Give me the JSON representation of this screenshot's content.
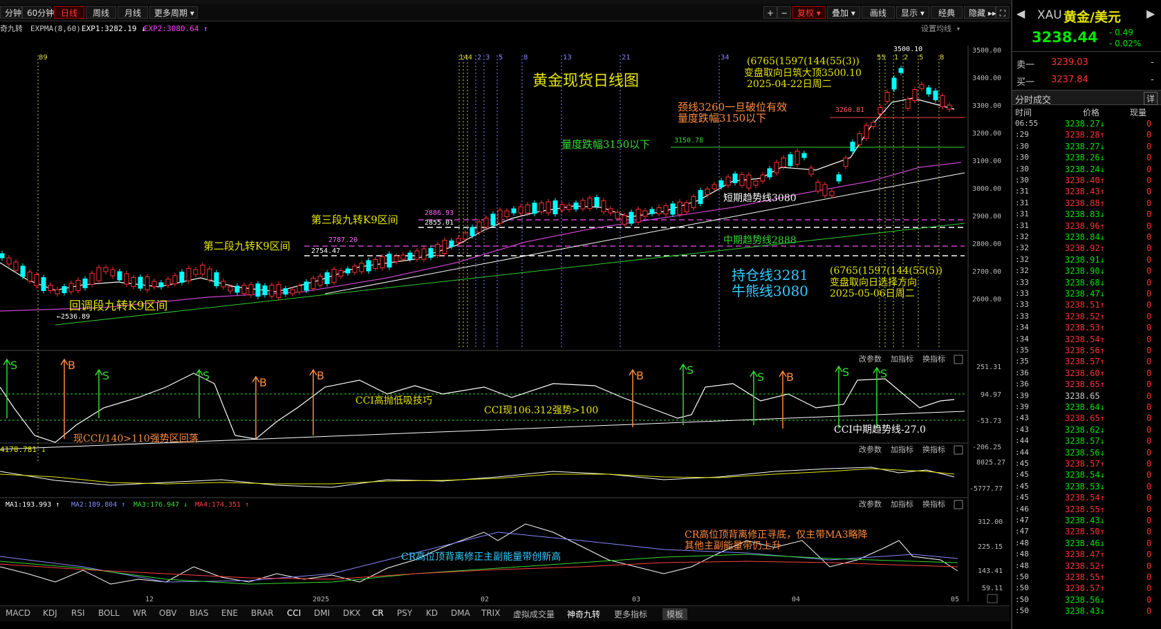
{
  "toolbar": {
    "periods": [
      "分钟",
      "60分钟",
      "日线",
      "周线",
      "月线",
      "更多周期 ▾"
    ],
    "active_period": "日线",
    "right_buttons": [
      "+",
      "−",
      "复权 ▾",
      "叠加 ▾",
      "画线",
      "显示 ▾",
      "经典",
      "隐藏 ▸▸",
      "⛶"
    ]
  },
  "indicator_bar": {
    "name": "奇九转",
    "expma": "EXPMA(8,60)",
    "exp1": "EXP1:3282.19 ↓",
    "exp2": "EXP2:3080.64 ↑",
    "settings": "设置均线 ▾"
  },
  "chart_title": "黄金现货日线图",
  "annotations": {
    "a1_line1": "(6765(1597(144(55(3))",
    "a1_line2": "变盘取向日筑大顶3500.10",
    "a1_line3": "2025-04-22日周二",
    "neck1": "颈线3260一旦破位有效",
    "neck2": "量度跌幅3150以下",
    "measure": "量度跌幅3150以下",
    "nine3": "第三段九转K9区间",
    "nine2": "第二段九转K9区间",
    "nine1": "回调段九转K9区间",
    "short_trend": "短期趋势线3080",
    "mid_trend": "中期趋势线2888",
    "hold": "持仓线3281",
    "bull": "牛熊线3080",
    "a2_line1": "(6765(1597(144(55(5))",
    "a2_line2": "变盘取向日选择方向",
    "a2_line3": "2025-05-06日周二",
    "cci1": "CCI高抛低吸技巧",
    "cci2": "CCI现106.312强势>100",
    "cci3": "现CCI/140>110强势区回落",
    "cci4": "CCI中期趋势线-27.0",
    "cr1": "CR高位顶背离修正主副能量带创新高",
    "cr2": "CR高位顶背离修正寻底，仅主带MA3略降",
    "cr3": "其他主副能量带仍上升"
  },
  "price_labels": {
    "p3500": "3500.10",
    "p3260": "3260.81",
    "p3150": "3150.78",
    "p2886": "2886.93",
    "p2855": "2855.01",
    "p2787": "2787.20",
    "p2754": "2754.47",
    "p2536": "←2536.89"
  },
  "count_labels": {
    "c89": "89",
    "c144": "144",
    "c2": "2",
    "c3": "3",
    "c5": "5",
    "c8": "8",
    "c13": "13",
    "c21": "21",
    "c34": "34",
    "c55": "55",
    "c1": "1"
  },
  "main_axis": [
    "3500.00",
    "3400.00",
    "3300.00",
    "3200.00",
    "3100.00",
    "3000.00",
    "2900.00",
    "2800.00",
    "2700.00",
    "2600.00"
  ],
  "cci_panel": {
    "controls": [
      "改参数",
      "加指标",
      "换指标"
    ],
    "axis": [
      "251.31",
      "94.97",
      "-53.73",
      "-206.25"
    ],
    "b_label": "B",
    "s_label": "S"
  },
  "vol_panel": {
    "header": "4178.781 ↓",
    "controls": [
      "改参数",
      "加指标",
      "换指标"
    ],
    "axis": [
      "8025.27",
      "-5777.77"
    ]
  },
  "cr_panel": {
    "ma1": "MA1:193.993 ↑",
    "ma2": "MA2:189.804 ↑",
    "ma3": "MA3:176.947 ↓",
    "ma4": "MA4:174.351 ↑",
    "controls": [
      "改参数",
      "加指标",
      "换指标"
    ],
    "axis": [
      "312.00",
      "225.15",
      "143.41",
      "59.11"
    ]
  },
  "x_axis": [
    "12",
    "2025",
    "02",
    "03",
    "04",
    "05"
  ],
  "bottom_tabs": [
    "MACD",
    "KDJ",
    "RSI",
    "BOLL",
    "WR",
    "OBV",
    "BIAS",
    "ENE",
    "BRAR",
    "CCI",
    "DMI",
    "DKX",
    "CR",
    "PSY",
    "KD",
    "DMA",
    "TRIX",
    "虚拟成交量",
    "神奇九转",
    "更多指标",
    "模板"
  ],
  "right_panel": {
    "symbol": "XAU",
    "name": "黄金/美元",
    "price": "3238.44",
    "change": "- 0.49",
    "change_pct": "- 0.02%",
    "sell_label": "卖一",
    "sell_price": "3239.03",
    "sell_vol": "-",
    "buy_label": "买一",
    "buy_price": "3237.84",
    "buy_vol": "-",
    "trade_title": "分时成交",
    "trade_btn": "详",
    "col_time": "时间",
    "col_price": "价格",
    "col_vol": "现量",
    "trades": [
      {
        "t": "06:55",
        "p": "3238.27",
        "d": "↓",
        "v": "0"
      },
      {
        "t": ":29",
        "p": "3238.28",
        "d": "↑",
        "v": "0"
      },
      {
        "t": ":30",
        "p": "3238.27",
        "d": "↓",
        "v": "0"
      },
      {
        "t": ":30",
        "p": "3238.26",
        "d": "↓",
        "v": "0"
      },
      {
        "t": ":30",
        "p": "3238.24",
        "d": "↓",
        "v": "0"
      },
      {
        "t": ":30",
        "p": "3238.40",
        "d": "↑",
        "v": "0"
      },
      {
        "t": ":31",
        "p": "3238.43",
        "d": "↑",
        "v": "0"
      },
      {
        "t": ":31",
        "p": "3238.88",
        "d": "↑",
        "v": "0"
      },
      {
        "t": ":31",
        "p": "3238.83",
        "d": "↓",
        "v": "0"
      },
      {
        "t": ":31",
        "p": "3238.96",
        "d": "↑",
        "v": "0"
      },
      {
        "t": ":32",
        "p": "3238.84",
        "d": "↓",
        "v": "0"
      },
      {
        "t": ":32",
        "p": "3238.92",
        "d": "↑",
        "v": "0"
      },
      {
        "t": ":32",
        "p": "3238.91",
        "d": "↓",
        "v": "0"
      },
      {
        "t": ":32",
        "p": "3238.90",
        "d": "↓",
        "v": "0"
      },
      {
        "t": ":33",
        "p": "3238.68",
        "d": "↓",
        "v": "0"
      },
      {
        "t": ":33",
        "p": "3238.47",
        "d": "↓",
        "v": "0"
      },
      {
        "t": ":33",
        "p": "3238.51",
        "d": "↑",
        "v": "0"
      },
      {
        "t": ":33",
        "p": "3238.52",
        "d": "↑",
        "v": "0"
      },
      {
        "t": ":34",
        "p": "3238.53",
        "d": "↑",
        "v": "0"
      },
      {
        "t": ":34",
        "p": "3238.54",
        "d": "↑",
        "v": "0"
      },
      {
        "t": ":35",
        "p": "3238.56",
        "d": "↑",
        "v": "0"
      },
      {
        "t": ":35",
        "p": "3238.57",
        "d": "↑",
        "v": "0"
      },
      {
        "t": ":36",
        "p": "3238.60",
        "d": "↑",
        "v": "0"
      },
      {
        "t": ":36",
        "p": "3238.65",
        "d": "↑",
        "v": "0"
      },
      {
        "t": ":39",
        "p": "3238.65",
        "d": "",
        "v": "0"
      },
      {
        "t": ":39",
        "p": "3238.64",
        "d": "↓",
        "v": "0"
      },
      {
        "t": ":43",
        "p": "3238.65",
        "d": "↑",
        "v": "0"
      },
      {
        "t": ":43",
        "p": "3238.62",
        "d": "↓",
        "v": "0"
      },
      {
        "t": ":44",
        "p": "3238.57",
        "d": "↓",
        "v": "0"
      },
      {
        "t": ":44",
        "p": "3238.56",
        "d": "↓",
        "v": "0"
      },
      {
        "t": ":45",
        "p": "3238.57",
        "d": "↑",
        "v": "0"
      },
      {
        "t": ":45",
        "p": "3238.54",
        "d": "↓",
        "v": "0"
      },
      {
        "t": ":45",
        "p": "3238.53",
        "d": "↓",
        "v": "0"
      },
      {
        "t": ":45",
        "p": "3238.54",
        "d": "↑",
        "v": "0"
      },
      {
        "t": ":46",
        "p": "3238.55",
        "d": "↑",
        "v": "0"
      },
      {
        "t": ":47",
        "p": "3238.43",
        "d": "↓",
        "v": "0"
      },
      {
        "t": ":47",
        "p": "3238.50",
        "d": "↑",
        "v": "0"
      },
      {
        "t": ":48",
        "p": "3238.46",
        "d": "↓",
        "v": "0"
      },
      {
        "t": ":48",
        "p": "3238.47",
        "d": "↑",
        "v": "0"
      },
      {
        "t": ":48",
        "p": "3238.52",
        "d": "↑",
        "v": "0"
      },
      {
        "t": ":50",
        "p": "3238.55",
        "d": "↑",
        "v": "0"
      },
      {
        "t": ":50",
        "p": "3238.57",
        "d": "↑",
        "v": "0"
      },
      {
        "t": ":50",
        "p": "3238.56",
        "d": "↓",
        "v": "0"
      },
      {
        "t": ":50",
        "p": "3238.43",
        "d": "↓",
        "v": "0"
      }
    ]
  },
  "colors": {
    "up": "#ff3232",
    "down": "#00e600",
    "candle_up": "#ff3232",
    "candle_down": "#00ffff",
    "annot_yellow": "#e6e600",
    "annot_orange": "#ff8c40",
    "annot_green": "#33dd33",
    "annot_cyan": "#33ccff"
  }
}
